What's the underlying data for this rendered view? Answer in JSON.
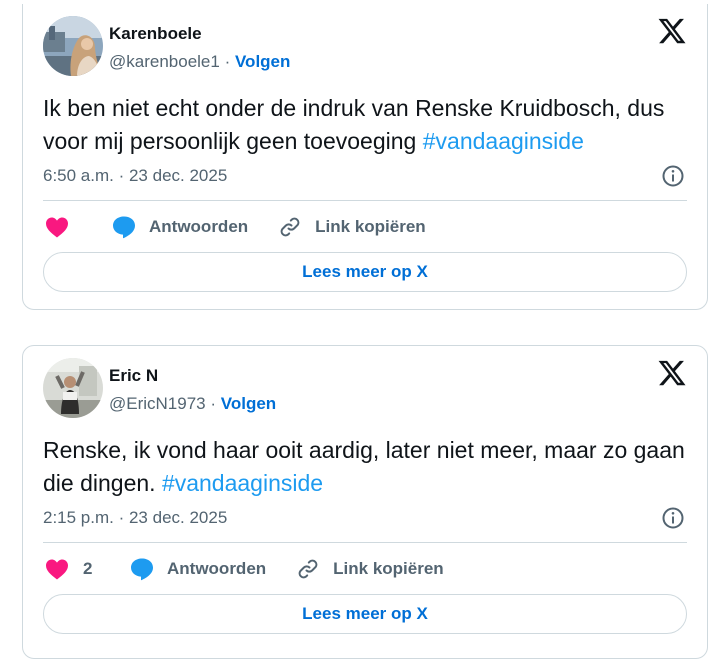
{
  "tweets": [
    {
      "name": "Karenboele",
      "handle": "@karenboele1",
      "separator": "·",
      "follow": "Volgen",
      "text": "Ik ben niet echt onder de indruk van Renske Kruidbosch, dus voor mij persoonlijk geen toevoeging ",
      "hashtag": "#vandaaginside",
      "time": "6:50 a.m. · 23 dec. 2025",
      "like_count": "",
      "reply_label": "Antwoorden",
      "copy_label": "Link kopiëren",
      "read_more": "Lees meer op X"
    },
    {
      "name": "Eric N",
      "handle": "@EricN1973",
      "separator": "·",
      "follow": "Volgen",
      "text": "Renske, ik vond haar ooit aardig, later niet meer, maar zo gaan die dingen. ",
      "hashtag": "#vandaaginside",
      "time": "2:15 p.m. · 23 dec. 2025",
      "like_count": "2",
      "reply_label": "Antwoorden",
      "copy_label": "Link kopiëren",
      "read_more": "Lees meer op X"
    }
  ],
  "icons": {
    "logo": "x-logo-icon",
    "info": "info-icon",
    "like": "heart-icon",
    "reply": "speech-bubble-icon",
    "copy": "link-icon"
  },
  "colors": {
    "like": "#f91880",
    "reply": "#1d9bf0",
    "follow": "#006fd6",
    "hashtag": "#1d9bf0",
    "muted": "#536471",
    "border": "#cfd9de"
  }
}
